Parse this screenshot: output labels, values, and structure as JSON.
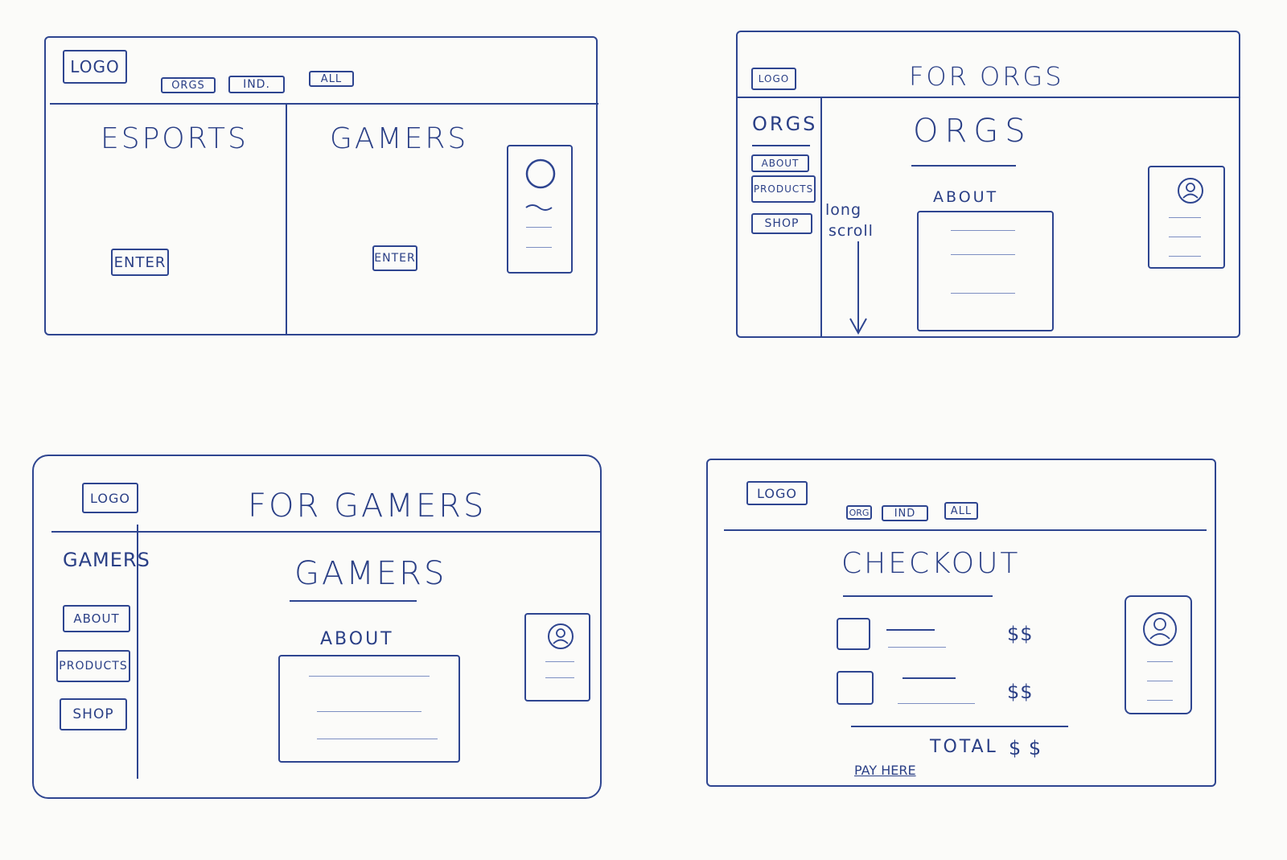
{
  "sketch1": {
    "logo": "LOGO",
    "nav": [
      "ORGS",
      "IND.",
      "ALL"
    ],
    "left_title": "ESPORTS",
    "right_title": "GAMERS",
    "enter_left": "ENTER",
    "enter_right": "ENTER"
  },
  "sketch2": {
    "logo": "LOGO",
    "header_title": "FOR ORGS",
    "sidebar_title": "ORGS",
    "sidebar_items": [
      "ABOUT",
      "PRODUCTS",
      "SHOP"
    ],
    "scroll_note_line1": "long",
    "scroll_note_line2": "scroll",
    "main_title": "ORGS",
    "about_label": "ABOUT"
  },
  "sketch3": {
    "logo": "LOGO",
    "header_title": "FOR GAMERS",
    "sidebar_title": "GAMERS",
    "sidebar_items": [
      "ABOUT",
      "PRODUCTS",
      "SHOP"
    ],
    "main_title": "GAMERS",
    "about_label": "ABOUT"
  },
  "sketch4": {
    "logo": "LOGO",
    "nav": [
      "ORG",
      "IND",
      "ALL"
    ],
    "title": "CHECKOUT",
    "items": [
      {
        "price": "$$"
      },
      {
        "price": "$$"
      }
    ],
    "total_label": "TOTAL",
    "total_value": "$ $",
    "pay_link": "PAY HERE"
  }
}
